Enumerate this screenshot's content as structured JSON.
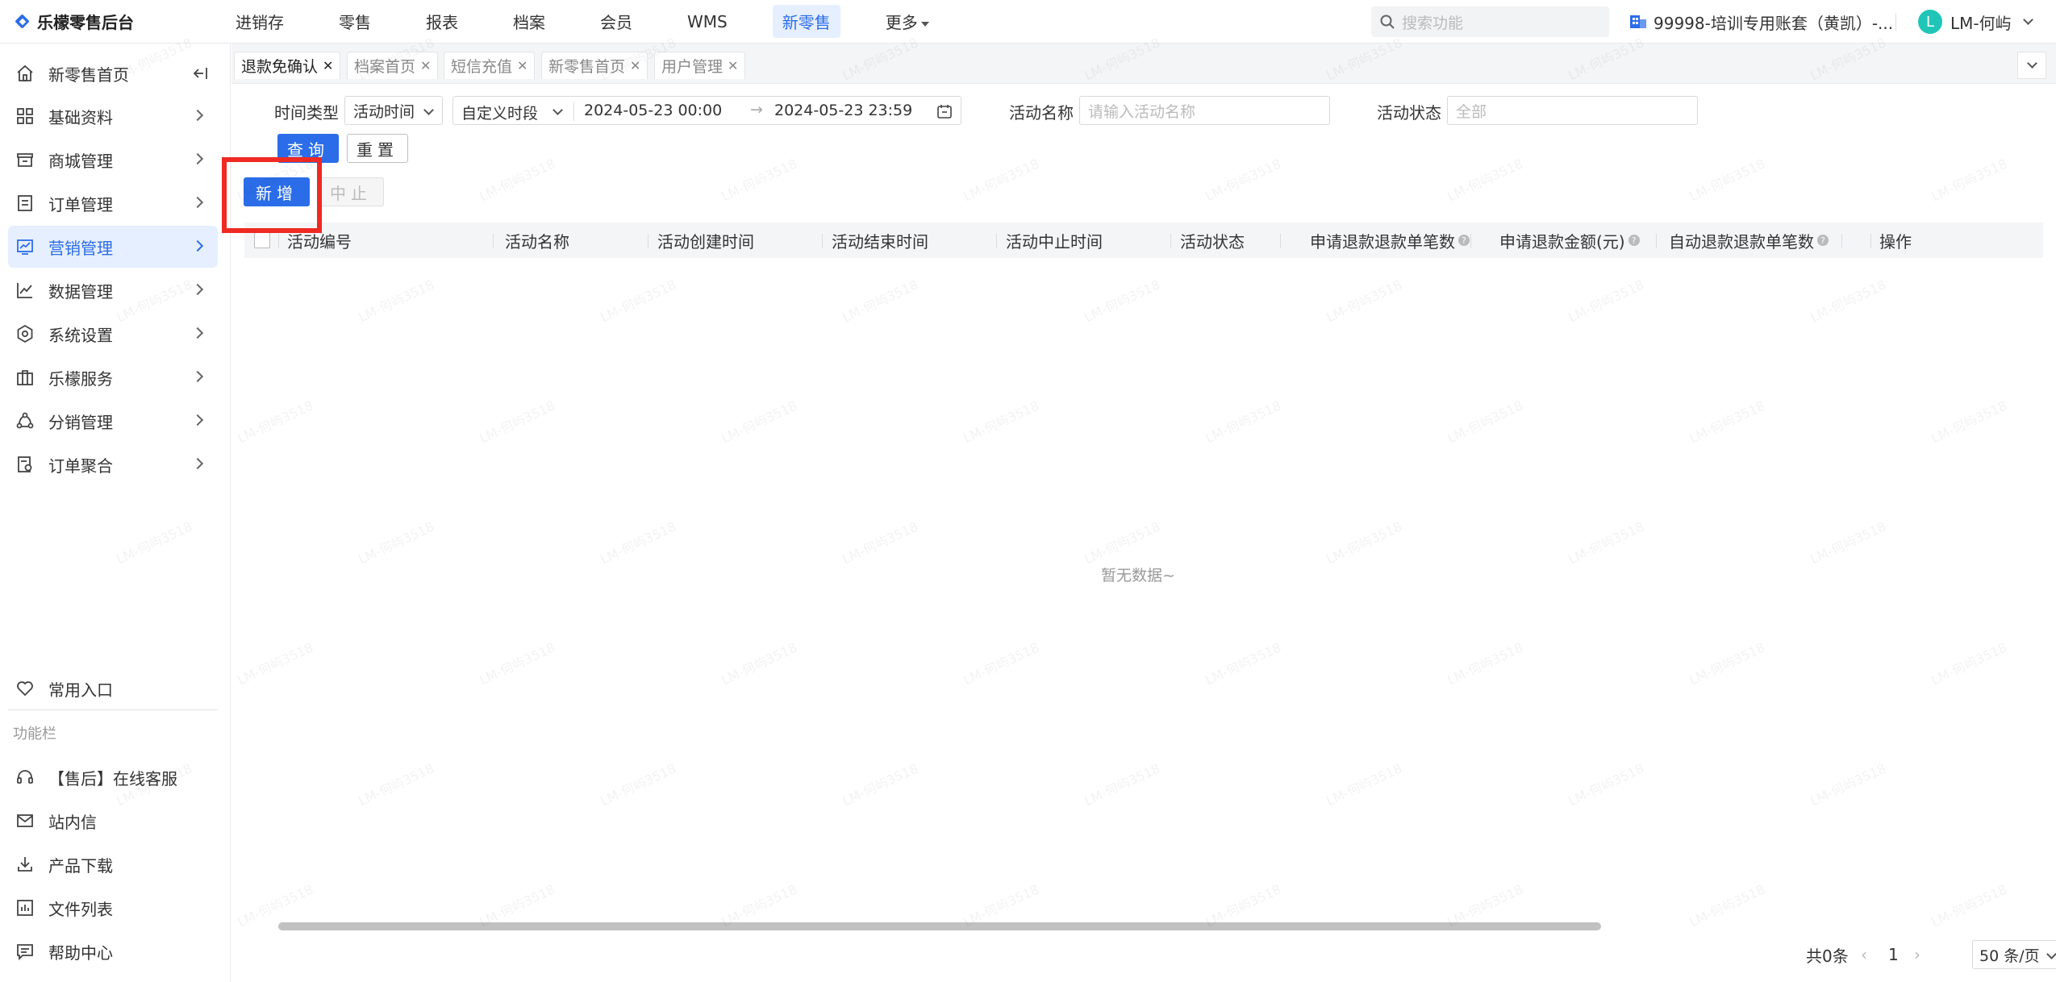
{
  "app": {
    "logo_text": "乐檬零售后台"
  },
  "topnav": [
    {
      "label": "进销存",
      "active": false
    },
    {
      "label": "零售",
      "active": false
    },
    {
      "label": "报表",
      "active": false
    },
    {
      "label": "档案",
      "active": false
    },
    {
      "label": "会员",
      "active": false
    },
    {
      "label": "WMS",
      "active": false
    },
    {
      "label": "新零售",
      "active": true
    },
    {
      "label": "更多",
      "active": false
    }
  ],
  "search": {
    "placeholder": "搜索功能"
  },
  "account": {
    "label": "99998-培训专用账套（黄凯）-..."
  },
  "user": {
    "avatar_letter": "L",
    "name": "LM-何屿"
  },
  "sidebar": {
    "items": [
      {
        "label": "新零售首页",
        "icon": "home-icon"
      },
      {
        "label": "基础资料",
        "icon": "grid-icon"
      },
      {
        "label": "商城管理",
        "icon": "store-icon"
      },
      {
        "label": "订单管理",
        "icon": "order-icon"
      },
      {
        "label": "营销管理",
        "icon": "marketing-icon"
      },
      {
        "label": "数据管理",
        "icon": "chart-icon"
      },
      {
        "label": "系统设置",
        "icon": "settings-icon"
      },
      {
        "label": "乐檬服务",
        "icon": "service-icon"
      },
      {
        "label": "分销管理",
        "icon": "distribution-icon"
      },
      {
        "label": "订单聚合",
        "icon": "aggregate-icon"
      }
    ],
    "favorites_label": "常用入口",
    "section_label": "功能栏",
    "function_items": [
      {
        "label": "【售后】在线客服",
        "icon": "headset-icon"
      },
      {
        "label": "站内信",
        "icon": "mail-icon"
      },
      {
        "label": "产品下载",
        "icon": "download-icon"
      },
      {
        "label": "文件列表",
        "icon": "file-list-icon"
      },
      {
        "label": "帮助中心",
        "icon": "help-icon"
      }
    ]
  },
  "tabs": [
    {
      "label": "退款免确认",
      "active": true
    },
    {
      "label": "档案首页",
      "active": false
    },
    {
      "label": "短信充值",
      "active": false
    },
    {
      "label": "新零售首页",
      "active": false
    },
    {
      "label": "用户管理",
      "active": false
    }
  ],
  "filters": {
    "time_type_label": "时间类型",
    "time_type_value": "活动时间",
    "period_value": "自定义时段",
    "start_time": "2024-05-23 00:00",
    "range_arrow": "→",
    "end_time": "2024-05-23 23:59",
    "activity_name_label": "活动名称",
    "activity_name_placeholder": "请输入活动名称",
    "activity_status_label": "活动状态",
    "activity_status_value": "全部"
  },
  "buttons": {
    "query": "查询",
    "reset": "重置",
    "add": "新增",
    "stop": "中止"
  },
  "table": {
    "columns": [
      "活动编号",
      "活动名称",
      "活动创建时间",
      "活动结束时间",
      "活动中止时间",
      "活动状态",
      "申请退款退款单笔数",
      "申请退款金额(元)",
      "自动退款退款单笔数",
      "操作"
    ],
    "empty_text": "暂无数据~"
  },
  "pagination": {
    "total": "共0条",
    "page": "1",
    "page_size": "50 条/页"
  },
  "watermark": "LM-何屿3518",
  "colors": {
    "primary": "#2b6de8",
    "highlight": "#ee2a23",
    "avatar": "#1fc6b8"
  }
}
